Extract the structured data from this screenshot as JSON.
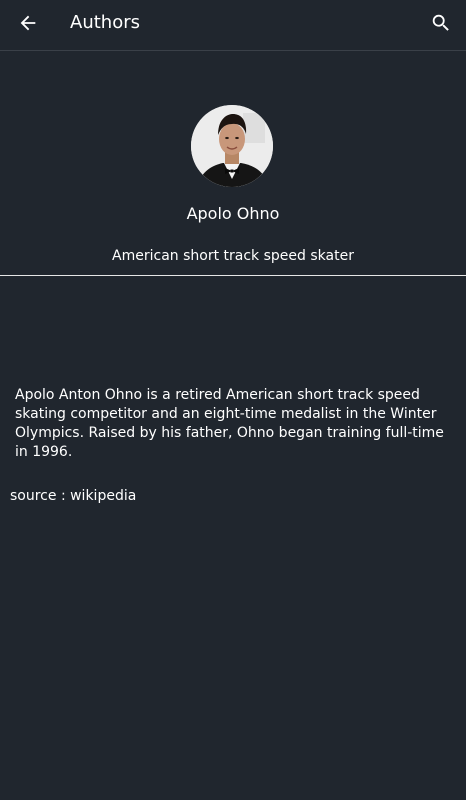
{
  "app_bar": {
    "title": "Authors",
    "back_icon": "arrow-back-icon",
    "search_icon": "search-icon"
  },
  "author": {
    "name": "Apolo Ohno",
    "short_description": "American short track speed skater",
    "bio": "Apolo Anton Ohno is a retired American short track speed skating competitor and an eight-time medalist in the Winter Olympics. Raised by his father, Ohno began training full-time in 1996.",
    "source": "source : wikipedia"
  },
  "colors": {
    "background": "#20262e",
    "text": "#ffffff",
    "divider": "#e6e6e6"
  }
}
